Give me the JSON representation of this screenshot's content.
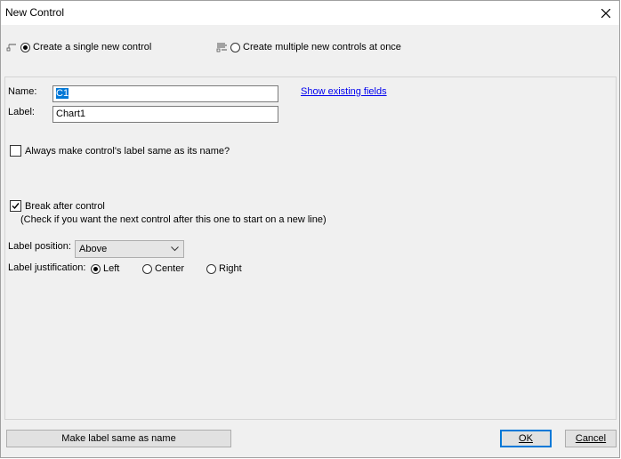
{
  "window": {
    "title": "New Control"
  },
  "mode": {
    "single_label": "Create a single new control",
    "multiple_label": "Create multiple new controls at once",
    "selected": "single"
  },
  "form": {
    "name_label": "Name:",
    "name_value": "C1",
    "label_label": "Label:",
    "label_value": "Chart1",
    "show_fields_link": "Show existing fields",
    "always_same_label": "Always make control's label same as its name?",
    "always_same_checked": false,
    "break_after_label": "Break after control",
    "break_after_checked": true,
    "break_after_hint": "(Check if you want the next control after this one to start on a new line)",
    "label_position_label": "Label position:",
    "label_position_value": "Above",
    "label_justification_label": "Label justification:",
    "justification_options": [
      "Left",
      "Center",
      "Right"
    ],
    "justification_selected": "Left"
  },
  "footer": {
    "make_same_button": "Make label same as name",
    "ok_button": "OK",
    "cancel_button": "Cancel"
  },
  "colors": {
    "accent": "#0078d7",
    "link": "#0000ee",
    "background": "#f0f0f0"
  }
}
